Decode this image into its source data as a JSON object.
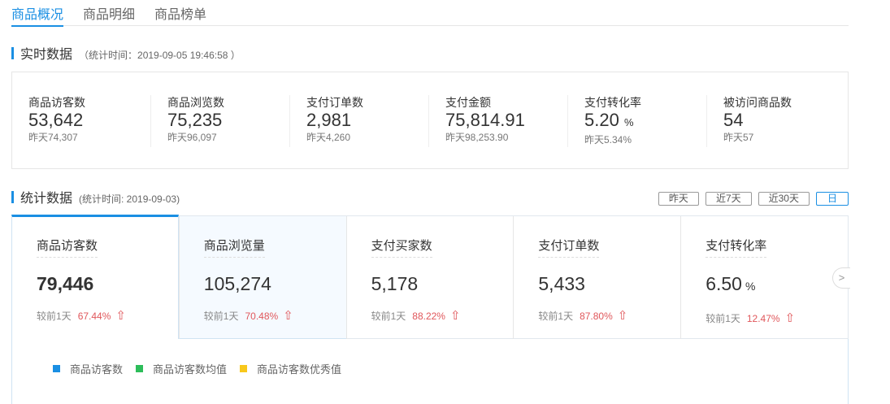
{
  "tabs": [
    "商品概况",
    "商品明细",
    "商品榜单"
  ],
  "realtime": {
    "title": "实时数据",
    "subtitle": "（统计时间：2019-09-05 19:46:58 ）",
    "items": [
      {
        "label": "商品访客数",
        "value": "53,642",
        "unit": "",
        "yesterday": "昨天74,307"
      },
      {
        "label": "商品浏览数",
        "value": "75,235",
        "unit": "",
        "yesterday": "昨天96,097"
      },
      {
        "label": "支付订单数",
        "value": "2,981",
        "unit": "",
        "yesterday": "昨天4,260"
      },
      {
        "label": "支付金额",
        "value": "75,814.91",
        "unit": "",
        "yesterday": "昨天98,253.90"
      },
      {
        "label": "支付转化率",
        "value": "5.20",
        "unit": "%",
        "yesterday": "昨天5.34%"
      },
      {
        "label": "被访问商品数",
        "value": "54",
        "unit": "",
        "yesterday": "昨天57"
      }
    ]
  },
  "stats": {
    "title": "统计数据",
    "subtitle": "(统计时间: 2019-09-03)",
    "ranges": [
      "昨天",
      "近7天",
      "近30天",
      "日"
    ],
    "compare_label": "较前1天",
    "cards": [
      {
        "label": "商品访客数",
        "value": "79,446",
        "unit": "",
        "change": "67.44%"
      },
      {
        "label": "商品浏览量",
        "value": "105,274",
        "unit": "",
        "change": "70.48%"
      },
      {
        "label": "支付买家数",
        "value": "5,178",
        "unit": "",
        "change": "88.22%"
      },
      {
        "label": "支付订单数",
        "value": "5,433",
        "unit": "",
        "change": "87.80%"
      },
      {
        "label": "支付转化率",
        "value": "6.50",
        "unit": "%",
        "change": "12.47%"
      }
    ]
  },
  "legend": [
    {
      "label": "商品访客数",
      "color": "#1a8fe3"
    },
    {
      "label": "商品访客数均值",
      "color": "#2dbd5a"
    },
    {
      "label": "商品访客数优秀值",
      "color": "#f8c81c"
    }
  ]
}
